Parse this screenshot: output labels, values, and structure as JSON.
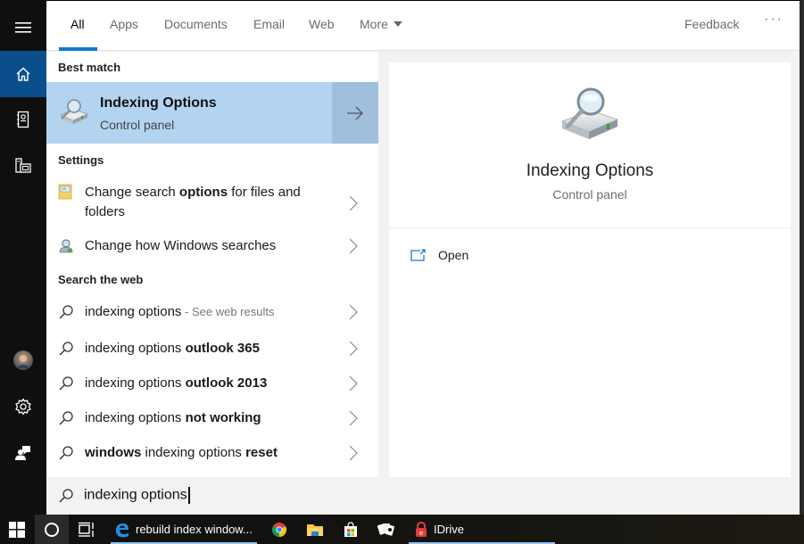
{
  "rail": {
    "items": [
      {
        "name": "menu",
        "icon": "hamburger-icon"
      },
      {
        "name": "home",
        "icon": "home-icon",
        "active": true
      },
      {
        "name": "notebook",
        "icon": "notebook-icon"
      },
      {
        "name": "devices",
        "icon": "devices-icon"
      },
      {
        "name": "account",
        "icon": "avatar-icon"
      },
      {
        "name": "settings",
        "icon": "gear-icon"
      },
      {
        "name": "feedback",
        "icon": "feedback-hub-icon"
      }
    ]
  },
  "tabs": {
    "items": [
      "All",
      "Apps",
      "Documents",
      "Email",
      "Web",
      "More"
    ],
    "active": "All",
    "feedback_label": "Feedback",
    "more_options": "···"
  },
  "results": {
    "best_match_header": "Best match",
    "best_match": {
      "title": "Indexing Options",
      "subtitle": "Control panel",
      "icon": "indexing-options-icon",
      "arrow_icon": "arrow-right-icon"
    },
    "settings_header": "Settings",
    "settings": [
      {
        "pre": "Change search ",
        "bold": "options",
        "post": " for files and",
        "line2": "folders",
        "icon": "folder-options-icon"
      },
      {
        "pre": "Change how Windows searches",
        "bold": "",
        "post": "",
        "line2": "",
        "icon": "search-settings-icon"
      }
    ],
    "web_header": "Search the web",
    "web": [
      {
        "parts": [
          {
            "t": "indexing options",
            "b": false
          }
        ],
        "hint": " - See web results"
      },
      {
        "parts": [
          {
            "t": "indexing options ",
            "b": false
          },
          {
            "t": "outlook 365",
            "b": true
          }
        ],
        "hint": ""
      },
      {
        "parts": [
          {
            "t": "indexing options ",
            "b": false
          },
          {
            "t": "outlook 2013",
            "b": true
          }
        ],
        "hint": ""
      },
      {
        "parts": [
          {
            "t": "indexing options ",
            "b": false
          },
          {
            "t": "not working",
            "b": true
          }
        ],
        "hint": ""
      },
      {
        "parts": [
          {
            "t": "windows",
            "b": true
          },
          {
            "t": " indexing options ",
            "b": false
          },
          {
            "t": "reset",
            "b": true
          }
        ],
        "hint": ""
      }
    ]
  },
  "preview": {
    "title": "Indexing Options",
    "subtitle": "Control panel",
    "actions": [
      {
        "label": "Open",
        "icon": "open-window-icon"
      }
    ]
  },
  "search": {
    "value": "indexing options",
    "icon": "search-icon"
  },
  "taskbar": {
    "items": [
      {
        "name": "start",
        "icon": "windows-logo-icon"
      },
      {
        "name": "cortana",
        "icon": "cortana-circle-icon"
      },
      {
        "name": "task-view",
        "icon": "task-view-icon"
      },
      {
        "name": "edge",
        "icon": "edge-icon",
        "label": "rebuild index window...",
        "open": true
      },
      {
        "name": "chrome",
        "icon": "chrome-icon"
      },
      {
        "name": "file-explorer",
        "icon": "folder-icon"
      },
      {
        "name": "store",
        "icon": "store-icon"
      },
      {
        "name": "solitaire",
        "icon": "cards-icon"
      },
      {
        "name": "idrive",
        "icon": "idrive-icon",
        "label": "IDrive",
        "open": true
      }
    ]
  },
  "colors": {
    "accent": "#0f78d4",
    "rail_active": "#0b4e8c",
    "best_match_bg": "#b3d4f0",
    "taskbar_underline": "#8fc6f0"
  }
}
